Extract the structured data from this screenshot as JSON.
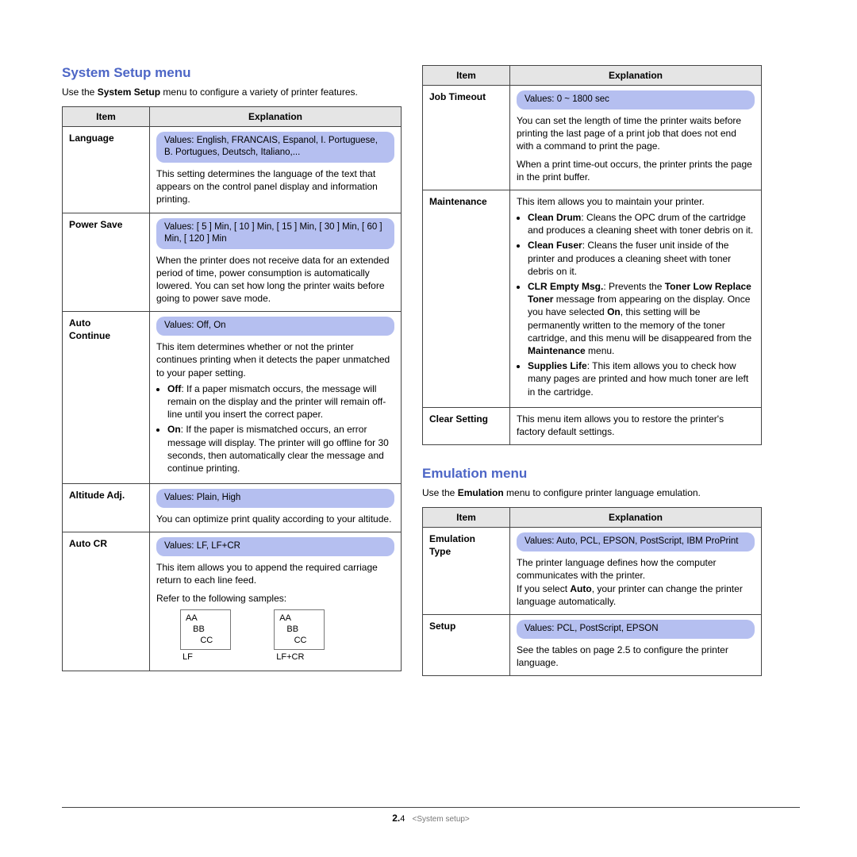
{
  "left": {
    "title": "System Setup menu",
    "intro_pre": "Use the ",
    "intro_bold": "System Setup",
    "intro_post": " menu to configure a variety of printer features.",
    "th_item": "Item",
    "th_expl": "Explanation",
    "rows": {
      "language": {
        "item": "Language",
        "values": "Values: English, FRANCAIS, Espanol, I. Portuguese, B. Portugues, Deutsch, Italiano,...",
        "text": "This setting determines the language of the text that appears on the control panel display and information printing."
      },
      "power_save": {
        "item": "Power Save",
        "values": "Values: [ 5 ] Min, [ 10 ] Min, [ 15 ] Min, [ 30 ] Min, [ 60 ] Min, [ 120 ] Min",
        "text": "When the printer does not receive data for an extended period of time, power consumption is automatically lowered. You can set how long the printer waits before going to power save mode."
      },
      "auto_continue": {
        "item1": "Auto",
        "item2": "Continue",
        "values": "Values: Off, On",
        "text": "This item determines whether or not the printer continues printing when it detects the paper unmatched to your paper setting.",
        "b1_bold": "Off",
        "b1_text": ": If a paper mismatch occurs, the message will remain on the display and the printer will remain off-line until you insert the correct paper.",
        "b2_bold": "On",
        "b2_text": ": If the paper is mismatched occurs, an error message will display. The printer will go offline for 30 seconds, then automatically clear the message and continue printing."
      },
      "altitude": {
        "item": "Altitude Adj.",
        "values": "Values: Plain, High",
        "text": "You can optimize print quality according to your altitude."
      },
      "auto_cr": {
        "item": "Auto CR",
        "values": "Values: LF, LF+CR",
        "text": "This item allows you to append the required carriage return to each line feed.",
        "refer": "Refer to the following samples:",
        "sample_text": "AA\n   BB\n      CC",
        "lf_label": "LF",
        "lfcr_label": "LF+CR"
      }
    }
  },
  "right_top": {
    "th_item": "Item",
    "th_expl": "Explanation",
    "rows": {
      "job_timeout": {
        "item": "Job Timeout",
        "values": "Values: 0 ~ 1800 sec",
        "p1": "You can set the length of time the printer waits before printing the last page of a print job that does not end with a command to print the page.",
        "p2": "When a print time-out occurs, the printer prints the page in the print buffer."
      },
      "maintenance": {
        "item": "Maintenance",
        "intro": "This item allows you to maintain your printer.",
        "b1_bold": "Clean Drum",
        "b1_text": ": Cleans the OPC drum of the cartridge and produces a cleaning sheet with toner debris on it.",
        "b2_bold": "Clean Fuser",
        "b2_text": ": Cleans the fuser unit inside of the printer and produces a cleaning sheet with toner debris on it.",
        "b3_bold": "CLR Empty Msg.",
        "b3_pre": ": Prevents the ",
        "b3_bold2": "Toner Low Replace Toner",
        "b3_mid": " message from appearing on the display. Once you have selected ",
        "b3_bold3": "On",
        "b3_mid2": ", this setting will be permanently written to the memory of the toner cartridge, and this menu will be disappeared from the ",
        "b3_bold4": "Maintenance",
        "b3_end": " menu.",
        "b4_bold": "Supplies Life",
        "b4_text": ": This item allows you to check how many pages are printed and how much toner are left in the cartridge."
      },
      "clear": {
        "item": "Clear Setting",
        "text": "This menu item allows you to restore the printer's factory default settings."
      }
    }
  },
  "emulation": {
    "title": "Emulation menu",
    "intro_pre": "Use the ",
    "intro_bold": "Emulation",
    "intro_post": " menu to configure printer language emulation.",
    "th_item": "Item",
    "th_expl": "Explanation",
    "rows": {
      "type": {
        "item1": "Emulation",
        "item2": "Type",
        "values": "Values: Auto, PCL, EPSON, PostScript, IBM ProPrint",
        "p1": "The printer language defines how the computer communicates with the printer.",
        "p2_pre": "If you select ",
        "p2_bold": "Auto",
        "p2_post": ", your printer can change the printer language automatically."
      },
      "setup": {
        "item": "Setup",
        "values": "Values: PCL, PostScript, EPSON",
        "text": "See the tables on page 2.5 to configure the printer language."
      }
    }
  },
  "footer": {
    "page": "2.",
    "num": "4",
    "chapter": "<System setup>"
  }
}
